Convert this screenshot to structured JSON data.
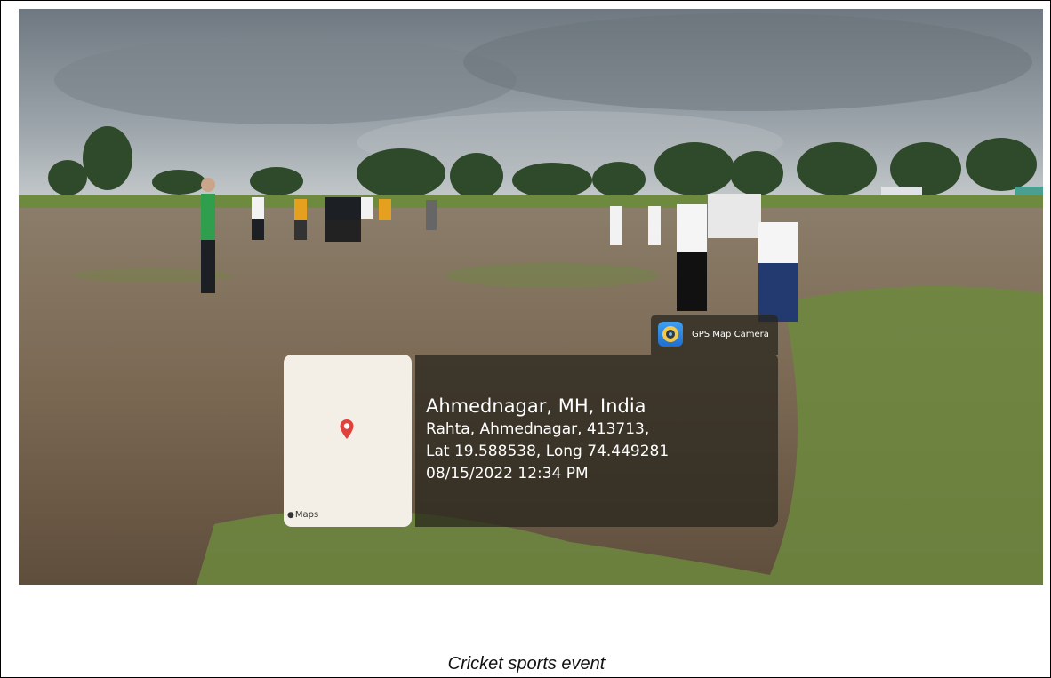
{
  "photo": {
    "map_tile": {
      "pin_icon": "location-pin-icon",
      "maps_label": "Maps"
    },
    "badge": {
      "icon": "gps-map-camera-app-icon",
      "label": "GPS Map Camera"
    },
    "info": {
      "title": "Ahmednagar, MH, India",
      "address": "Rahta, Ahmednagar, 413713,",
      "coordinates": "Lat 19.588538, Long 74.449281",
      "datetime": "08/15/2022 12:34 PM"
    }
  },
  "caption": "Cricket sports event",
  "colors": {
    "sky": "#8c959c",
    "ground": "#7d6b57",
    "grass": "#6e8a3f",
    "pin": "#e0413a"
  }
}
